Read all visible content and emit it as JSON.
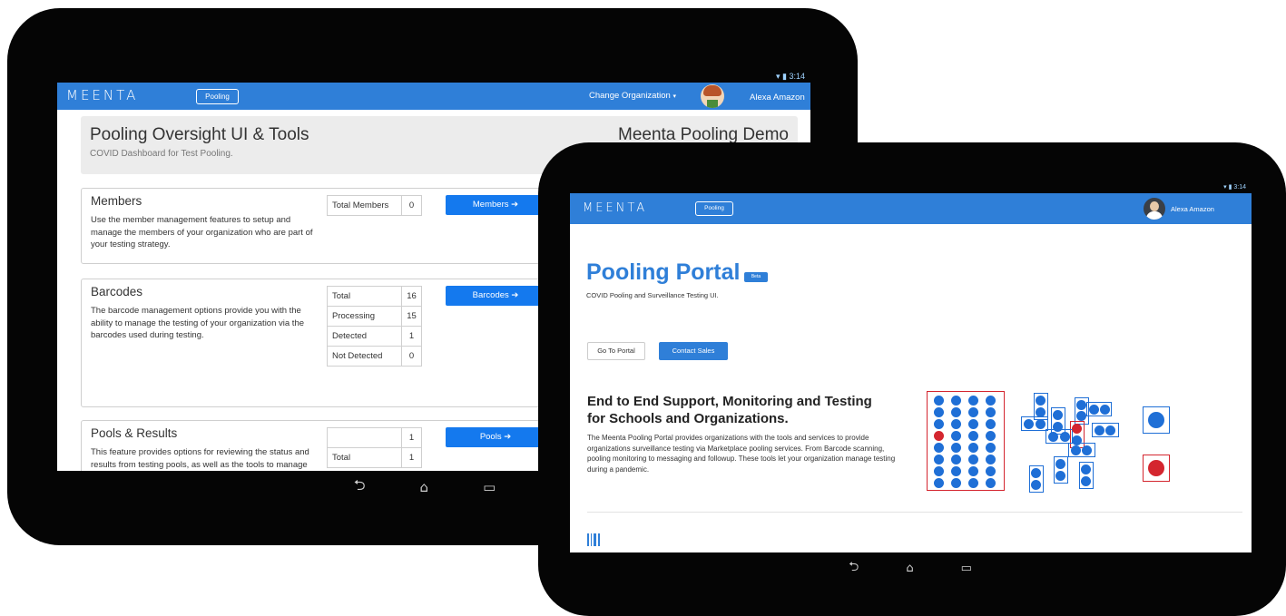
{
  "back_tablet": {
    "status_time": "3:14",
    "header": {
      "logo": "MEENTA",
      "section_pill": "Pooling",
      "org_menu": "Change Organization",
      "user_name": "Alexa Amazon"
    },
    "jumbotron": {
      "title": "Pooling Oversight UI & Tools",
      "subtitle": "COVID Dashboard for Test Pooling.",
      "org_name": "Meenta Pooling Demo"
    },
    "members": {
      "title": "Members",
      "description": "Use the member management features to setup and manage the members of your organization who are part of your testing strategy.",
      "stats": [
        {
          "label": "Total Members",
          "value": "0"
        }
      ],
      "button": "Members ➔"
    },
    "barcodes": {
      "title": "Barcodes",
      "description": "The barcode management options provide you with the ability to manage the testing of your organization via the barcodes used during testing.",
      "stats": [
        {
          "label": "Total",
          "value": "16"
        },
        {
          "label": "Processing",
          "value": "15"
        },
        {
          "label": "Detected",
          "value": "1"
        },
        {
          "label": "Not Detected",
          "value": "0"
        }
      ],
      "button": "Barcodes ➔"
    },
    "pools": {
      "title": "Pools & Results",
      "description": "This feature provides options for reviewing the status and results from testing pools, as well as the tools to manage communications and follow-up testing.",
      "stats": [
        {
          "label": "",
          "value": "1"
        },
        {
          "label": "Total",
          "value": "1"
        }
      ],
      "button": "Pools ➔"
    }
  },
  "front_tablet": {
    "status_time": "3:14",
    "header": {
      "logo": "MEENTA",
      "section_pill": "Pooling",
      "user_name": "Alexa Amazon"
    },
    "hero": {
      "title": "Pooling Portal",
      "badge": "Beta",
      "subtitle": "COVID Pooling and Surveillance Testing UI.",
      "go_button": "Go To Portal",
      "contact_button": "Contact Sales"
    },
    "feature": {
      "headline": "End to End Support, Monitoring and Testing for Schools and Organizations.",
      "body": "The Meenta Pooling Portal provides organizations with the tools and services to provide organizations surveillance testing via Marketplace pooling services. From Barcode scanning, pooling monitoring to messaging and followup. These tools let your organization manage testing during a pandemic."
    }
  },
  "icons": {
    "wifi": "wifi-icon",
    "battery": "battery-icon",
    "back": "back-nav-icon",
    "home": "home-nav-icon",
    "recents": "recents-nav-icon",
    "avatar": "user-avatar",
    "barcode": "barcode-icon"
  },
  "colors": {
    "brand_blue": "#2f7fd8",
    "button_blue": "#1479ee",
    "detected_red": "#d4262f",
    "sample_blue": "#1f6fd6"
  }
}
